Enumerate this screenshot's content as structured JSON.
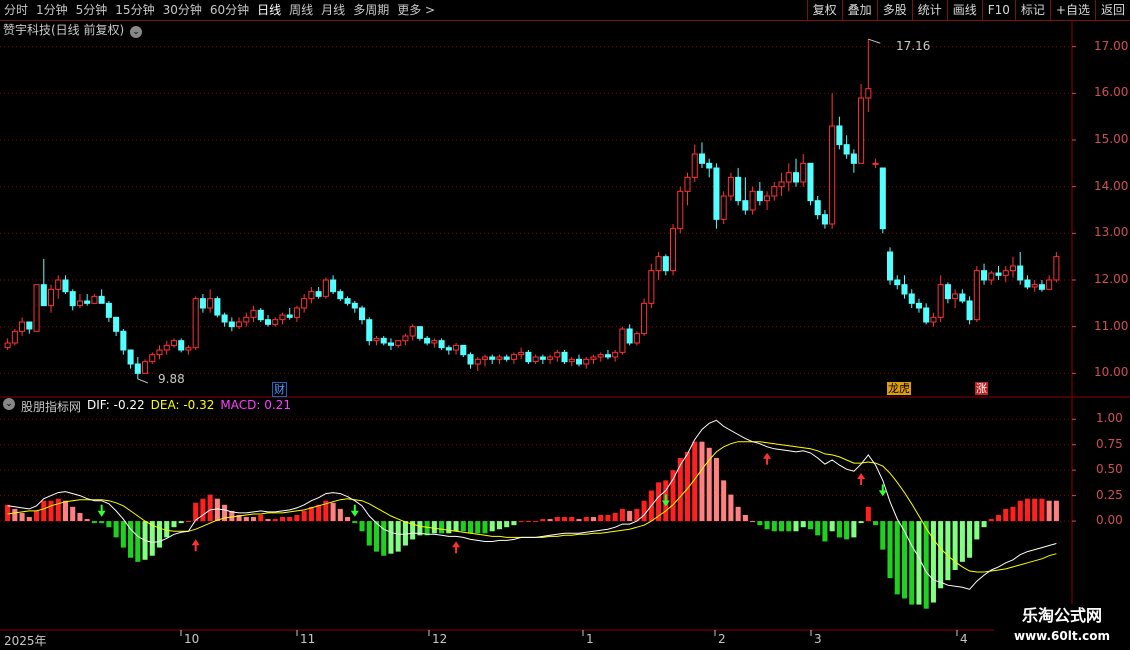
{
  "toolbar": {
    "periods": [
      "分时",
      "1分钟",
      "5分钟",
      "15分钟",
      "30分钟",
      "60分钟",
      "日线",
      "周线",
      "月线",
      "多周期",
      "更多 >"
    ],
    "active_period": "日线",
    "tools": [
      "复权",
      "叠加",
      "多股",
      "统计",
      "画线",
      "F10",
      "标记",
      "+自选",
      "返回"
    ]
  },
  "stock": {
    "title": "赞宇科技(日线 前复权)",
    "dropdown_icon": "chevron-down-icon"
  },
  "price_axis": {
    "ticks": [
      "17.00",
      "16.00",
      "15.00",
      "14.00",
      "13.00",
      "12.00",
      "11.00",
      "10.00"
    ]
  },
  "annotations": {
    "high": "17.16",
    "low": "9.88"
  },
  "badges": [
    {
      "text": "财",
      "color": "#2060c0"
    },
    {
      "text": "龙虎",
      "color": "#e0a000"
    },
    {
      "text": "涨",
      "color": "#c02020"
    }
  ],
  "indicator": {
    "name": "股朋指标网",
    "dif_label": "DIF: -0.22",
    "dea_label": "DEA: -0.32",
    "macd_label": "MACD: 0.21",
    "ticks": [
      "1.00",
      "0.75",
      "0.50",
      "0.25",
      "0.00"
    ]
  },
  "time_axis": {
    "labels": [
      "2025年",
      "10",
      "11",
      "12",
      "1",
      "2",
      "3",
      "4"
    ]
  },
  "watermark": {
    "title": "乐淘公式网",
    "url": "www.60lt.com"
  },
  "colors": {
    "up": "#ff3232",
    "down": "#54ffff",
    "grid": "#8b0000",
    "dif": "#ffffff",
    "dea": "#ffff00",
    "macd_up": "#ff2020",
    "macd_up_weak": "#ff8080",
    "macd_down": "#20d020",
    "macd_down_weak": "#80ff80"
  },
  "chart_data": {
    "type": "candlestick",
    "price_ylim": [
      9.6,
      17.4
    ],
    "macd_ylim": [
      -1.05,
      1.15
    ],
    "candles": [
      [
        10.55,
        10.75,
        10.5,
        10.65
      ],
      [
        10.65,
        10.95,
        10.6,
        10.9
      ],
      [
        10.9,
        11.2,
        10.8,
        11.1
      ],
      [
        11.1,
        11.05,
        10.85,
        10.95
      ],
      [
        10.9,
        11.9,
        10.9,
        11.9
      ],
      [
        11.9,
        12.45,
        11.8,
        11.45
      ],
      [
        11.45,
        11.9,
        11.3,
        11.8
      ],
      [
        11.8,
        12.1,
        11.6,
        12.0
      ],
      [
        12.0,
        12.1,
        11.7,
        11.75
      ],
      [
        11.75,
        11.8,
        11.35,
        11.45
      ],
      [
        11.45,
        11.7,
        11.4,
        11.55
      ],
      [
        11.55,
        11.7,
        11.45,
        11.5
      ],
      [
        11.5,
        11.7,
        11.55,
        11.65
      ],
      [
        11.65,
        11.8,
        11.55,
        11.5
      ],
      [
        11.5,
        11.55,
        11.1,
        11.2
      ],
      [
        11.2,
        11.2,
        10.8,
        10.9
      ],
      [
        10.9,
        10.95,
        10.4,
        10.5
      ],
      [
        10.5,
        10.5,
        10.1,
        10.2
      ],
      [
        10.2,
        10.35,
        9.88,
        10.0
      ],
      [
        10.0,
        10.3,
        10.0,
        10.25
      ],
      [
        10.25,
        10.45,
        10.2,
        10.4
      ],
      [
        10.4,
        10.6,
        10.3,
        10.5
      ],
      [
        10.5,
        10.7,
        10.4,
        10.6
      ],
      [
        10.6,
        10.75,
        10.55,
        10.7
      ],
      [
        10.7,
        10.75,
        10.45,
        10.5
      ],
      [
        10.5,
        10.6,
        10.4,
        10.55
      ],
      [
        10.55,
        11.65,
        10.5,
        11.6
      ],
      [
        11.6,
        11.7,
        11.3,
        11.4
      ],
      [
        11.4,
        11.8,
        11.3,
        11.6
      ],
      [
        11.6,
        11.65,
        11.2,
        11.25
      ],
      [
        11.25,
        11.3,
        11.0,
        11.1
      ],
      [
        11.1,
        11.2,
        10.9,
        11.0
      ],
      [
        11.0,
        11.2,
        10.95,
        11.1
      ],
      [
        11.1,
        11.3,
        11.0,
        11.2
      ],
      [
        11.2,
        11.45,
        11.1,
        11.35
      ],
      [
        11.35,
        11.4,
        11.1,
        11.15
      ],
      [
        11.15,
        11.25,
        11.0,
        11.05
      ],
      [
        11.05,
        11.2,
        11.0,
        11.15
      ],
      [
        11.15,
        11.3,
        11.05,
        11.25
      ],
      [
        11.25,
        11.4,
        11.15,
        11.2
      ],
      [
        11.2,
        11.45,
        11.1,
        11.4
      ],
      [
        11.4,
        11.7,
        11.3,
        11.6
      ],
      [
        11.6,
        11.85,
        11.5,
        11.75
      ],
      [
        11.75,
        11.85,
        11.6,
        11.65
      ],
      [
        11.65,
        12.05,
        11.6,
        12.0
      ],
      [
        12.0,
        12.1,
        11.7,
        11.75
      ],
      [
        11.75,
        11.8,
        11.55,
        11.6
      ],
      [
        11.6,
        11.65,
        11.45,
        11.5
      ],
      [
        11.5,
        11.55,
        11.3,
        11.4
      ],
      [
        11.4,
        11.45,
        11.05,
        11.15
      ],
      [
        11.15,
        11.2,
        10.6,
        10.7
      ],
      [
        10.7,
        10.8,
        10.6,
        10.75
      ],
      [
        10.75,
        10.8,
        10.6,
        10.65
      ],
      [
        10.65,
        10.75,
        10.5,
        10.6
      ],
      [
        10.6,
        10.7,
        10.55,
        10.7
      ],
      [
        10.7,
        10.85,
        10.6,
        10.8
      ],
      [
        10.8,
        11.05,
        10.7,
        11.0
      ],
      [
        11.0,
        11.0,
        10.7,
        10.75
      ],
      [
        10.75,
        10.8,
        10.6,
        10.65
      ],
      [
        10.65,
        10.75,
        10.55,
        10.7
      ],
      [
        10.7,
        10.75,
        10.5,
        10.55
      ],
      [
        10.55,
        10.6,
        10.4,
        10.5
      ],
      [
        10.5,
        10.65,
        10.4,
        10.6
      ],
      [
        10.6,
        10.6,
        10.35,
        10.4
      ],
      [
        10.4,
        10.45,
        10.1,
        10.2
      ],
      [
        10.2,
        10.35,
        10.05,
        10.3
      ],
      [
        10.3,
        10.4,
        10.15,
        10.35
      ],
      [
        10.35,
        10.4,
        10.2,
        10.3
      ],
      [
        10.3,
        10.4,
        10.2,
        10.35
      ],
      [
        10.35,
        10.4,
        10.25,
        10.3
      ],
      [
        10.3,
        10.45,
        10.2,
        10.4
      ],
      [
        10.4,
        10.55,
        10.3,
        10.45
      ],
      [
        10.45,
        10.5,
        10.2,
        10.25
      ],
      [
        10.25,
        10.4,
        10.2,
        10.35
      ],
      [
        10.35,
        10.4,
        10.2,
        10.3
      ],
      [
        10.3,
        10.4,
        10.2,
        10.35
      ],
      [
        10.35,
        10.5,
        10.25,
        10.45
      ],
      [
        10.45,
        10.5,
        10.2,
        10.25
      ],
      [
        10.25,
        10.35,
        10.15,
        10.3
      ],
      [
        10.3,
        10.4,
        10.15,
        10.2
      ],
      [
        10.2,
        10.35,
        10.1,
        10.3
      ],
      [
        10.3,
        10.4,
        10.2,
        10.35
      ],
      [
        10.35,
        10.45,
        10.25,
        10.4
      ],
      [
        10.4,
        10.5,
        10.3,
        10.35
      ],
      [
        10.35,
        10.5,
        10.25,
        10.45
      ],
      [
        10.45,
        11.0,
        10.4,
        10.95
      ],
      [
        10.95,
        11.05,
        10.6,
        10.65
      ],
      [
        10.65,
        10.9,
        10.6,
        10.85
      ],
      [
        10.85,
        11.6,
        10.8,
        11.5
      ],
      [
        11.5,
        12.35,
        11.4,
        12.2
      ],
      [
        12.2,
        12.6,
        12.0,
        12.5
      ],
      [
        12.5,
        12.55,
        12.1,
        12.2
      ],
      [
        12.2,
        13.2,
        12.1,
        13.1
      ],
      [
        13.1,
        14.0,
        13.0,
        13.9
      ],
      [
        13.9,
        14.3,
        13.6,
        14.2
      ],
      [
        14.2,
        14.9,
        14.1,
        14.7
      ],
      [
        14.7,
        14.95,
        14.4,
        14.5
      ],
      [
        14.5,
        14.6,
        14.2,
        14.4
      ],
      [
        14.4,
        14.5,
        13.1,
        13.3
      ],
      [
        13.3,
        13.9,
        13.2,
        13.8
      ],
      [
        13.8,
        14.3,
        13.7,
        14.2
      ],
      [
        14.2,
        14.4,
        13.6,
        13.7
      ],
      [
        13.7,
        14.2,
        13.4,
        13.5
      ],
      [
        13.5,
        14.0,
        13.4,
        13.9
      ],
      [
        13.9,
        14.1,
        13.6,
        13.7
      ],
      [
        13.7,
        13.9,
        13.5,
        13.8
      ],
      [
        13.8,
        14.1,
        13.7,
        14.0
      ],
      [
        14.0,
        14.3,
        13.8,
        14.1
      ],
      [
        14.1,
        14.5,
        13.9,
        14.3
      ],
      [
        14.3,
        14.6,
        14.0,
        14.1
      ],
      [
        14.1,
        14.7,
        14.0,
        14.5
      ],
      [
        14.5,
        14.5,
        13.6,
        13.7
      ],
      [
        13.7,
        13.8,
        13.3,
        13.4
      ],
      [
        13.4,
        13.5,
        13.1,
        13.2
      ],
      [
        13.2,
        16.0,
        13.1,
        15.3
      ],
      [
        15.3,
        15.5,
        14.8,
        14.9
      ],
      [
        14.9,
        15.1,
        14.6,
        14.7
      ],
      [
        14.7,
        14.8,
        14.3,
        14.5
      ],
      [
        14.5,
        16.2,
        14.5,
        15.9
      ],
      [
        15.9,
        17.16,
        15.6,
        16.1
      ],
      [
        14.5,
        14.6,
        14.4,
        14.5
      ],
      [
        14.4,
        14.4,
        13.0,
        13.1
      ],
      [
        12.6,
        12.7,
        11.9,
        12.0
      ],
      [
        12.0,
        12.1,
        11.8,
        11.9
      ],
      [
        11.9,
        12.1,
        11.6,
        11.7
      ],
      [
        11.7,
        11.8,
        11.4,
        11.5
      ],
      [
        11.5,
        11.6,
        11.3,
        11.4
      ],
      [
        11.4,
        11.5,
        11.05,
        11.1
      ],
      [
        11.1,
        11.3,
        11.0,
        11.2
      ],
      [
        11.2,
        12.1,
        11.1,
        11.9
      ],
      [
        11.9,
        11.95,
        11.5,
        11.6
      ],
      [
        11.6,
        11.8,
        11.4,
        11.7
      ],
      [
        11.7,
        11.8,
        11.5,
        11.55
      ],
      [
        11.55,
        11.65,
        11.05,
        11.15
      ],
      [
        11.15,
        12.3,
        11.1,
        12.2
      ],
      [
        12.2,
        12.35,
        11.9,
        12.0
      ],
      [
        12.0,
        12.2,
        11.9,
        12.15
      ],
      [
        12.15,
        12.3,
        12.0,
        12.1
      ],
      [
        12.1,
        12.3,
        11.95,
        12.2
      ],
      [
        12.2,
        12.5,
        12.05,
        12.3
      ],
      [
        12.3,
        12.6,
        11.9,
        12.0
      ],
      [
        12.0,
        12.1,
        11.8,
        11.85
      ],
      [
        11.85,
        12.0,
        11.75,
        11.9
      ],
      [
        11.9,
        12.0,
        11.75,
        11.8
      ],
      [
        11.8,
        12.1,
        11.8,
        12.0
      ],
      [
        12.0,
        12.6,
        11.95,
        12.5
      ]
    ],
    "dif": [
      0.15,
      0.14,
      0.13,
      0.12,
      0.15,
      0.22,
      0.25,
      0.28,
      0.29,
      0.27,
      0.25,
      0.22,
      0.2,
      0.2,
      0.17,
      0.1,
      0.02,
      -0.08,
      -0.15,
      -0.19,
      -0.21,
      -0.2,
      -0.17,
      -0.13,
      -0.11,
      -0.1,
      0.01,
      0.06,
      0.11,
      0.12,
      0.11,
      0.09,
      0.08,
      0.08,
      0.09,
      0.1,
      0.09,
      0.09,
      0.1,
      0.11,
      0.13,
      0.16,
      0.2,
      0.23,
      0.27,
      0.28,
      0.27,
      0.24,
      0.2,
      0.15,
      0.05,
      -0.02,
      -0.08,
      -0.11,
      -0.13,
      -0.13,
      -0.12,
      -0.12,
      -0.13,
      -0.13,
      -0.14,
      -0.15,
      -0.15,
      -0.16,
      -0.18,
      -0.19,
      -0.2,
      -0.2,
      -0.19,
      -0.19,
      -0.18,
      -0.16,
      -0.16,
      -0.16,
      -0.15,
      -0.14,
      -0.13,
      -0.12,
      -0.12,
      -0.12,
      -0.11,
      -0.1,
      -0.09,
      -0.08,
      -0.06,
      -0.03,
      -0.03,
      0.0,
      0.06,
      0.15,
      0.24,
      0.3,
      0.41,
      0.55,
      0.66,
      0.8,
      0.9,
      0.96,
      0.99,
      0.93,
      0.89,
      0.85,
      0.81,
      0.78,
      0.76,
      0.73,
      0.71,
      0.7,
      0.69,
      0.68,
      0.69,
      0.67,
      0.62,
      0.56,
      0.6,
      0.55,
      0.51,
      0.49,
      0.56,
      0.65,
      0.55,
      0.4,
      0.19,
      0.02,
      -0.1,
      -0.24,
      -0.36,
      -0.5,
      -0.58,
      -0.6,
      -0.63,
      -0.64,
      -0.65,
      -0.67,
      -0.59,
      -0.53,
      -0.48,
      -0.45,
      -0.41,
      -0.38,
      -0.33,
      -0.3,
      -0.28,
      -0.26,
      -0.24,
      -0.22
    ],
    "dea": [
      0.07,
      0.08,
      0.09,
      0.1,
      0.1,
      0.12,
      0.15,
      0.17,
      0.19,
      0.2,
      0.21,
      0.21,
      0.21,
      0.21,
      0.2,
      0.18,
      0.15,
      0.1,
      0.05,
      0.0,
      -0.04,
      -0.07,
      -0.09,
      -0.1,
      -0.1,
      -0.1,
      -0.08,
      -0.05,
      -0.02,
      0.01,
      0.03,
      0.04,
      0.05,
      0.06,
      0.07,
      0.07,
      0.08,
      0.08,
      0.08,
      0.09,
      0.1,
      0.11,
      0.13,
      0.15,
      0.17,
      0.19,
      0.21,
      0.22,
      0.21,
      0.2,
      0.17,
      0.13,
      0.09,
      0.05,
      0.02,
      -0.01,
      -0.03,
      -0.05,
      -0.06,
      -0.07,
      -0.08,
      -0.09,
      -0.1,
      -0.11,
      -0.12,
      -0.13,
      -0.14,
      -0.15,
      -0.15,
      -0.16,
      -0.16,
      -0.16,
      -0.16,
      -0.16,
      -0.16,
      -0.15,
      -0.15,
      -0.14,
      -0.14,
      -0.13,
      -0.13,
      -0.12,
      -0.12,
      -0.11,
      -0.1,
      -0.09,
      -0.08,
      -0.06,
      -0.04,
      0.0,
      0.05,
      0.1,
      0.16,
      0.24,
      0.32,
      0.41,
      0.51,
      0.6,
      0.68,
      0.73,
      0.76,
      0.78,
      0.78,
      0.78,
      0.78,
      0.77,
      0.76,
      0.75,
      0.74,
      0.73,
      0.72,
      0.71,
      0.69,
      0.66,
      0.65,
      0.63,
      0.6,
      0.57,
      0.57,
      0.58,
      0.57,
      0.54,
      0.47,
      0.38,
      0.28,
      0.17,
      0.05,
      -0.07,
      -0.18,
      -0.27,
      -0.34,
      -0.4,
      -0.45,
      -0.49,
      -0.5,
      -0.5,
      -0.49,
      -0.48,
      -0.47,
      -0.45,
      -0.43,
      -0.41,
      -0.39,
      -0.37,
      -0.34,
      -0.32
    ],
    "arrows_up": [
      26,
      62,
      105,
      118
    ],
    "arrows_down": [
      13,
      48,
      91,
      121
    ]
  }
}
